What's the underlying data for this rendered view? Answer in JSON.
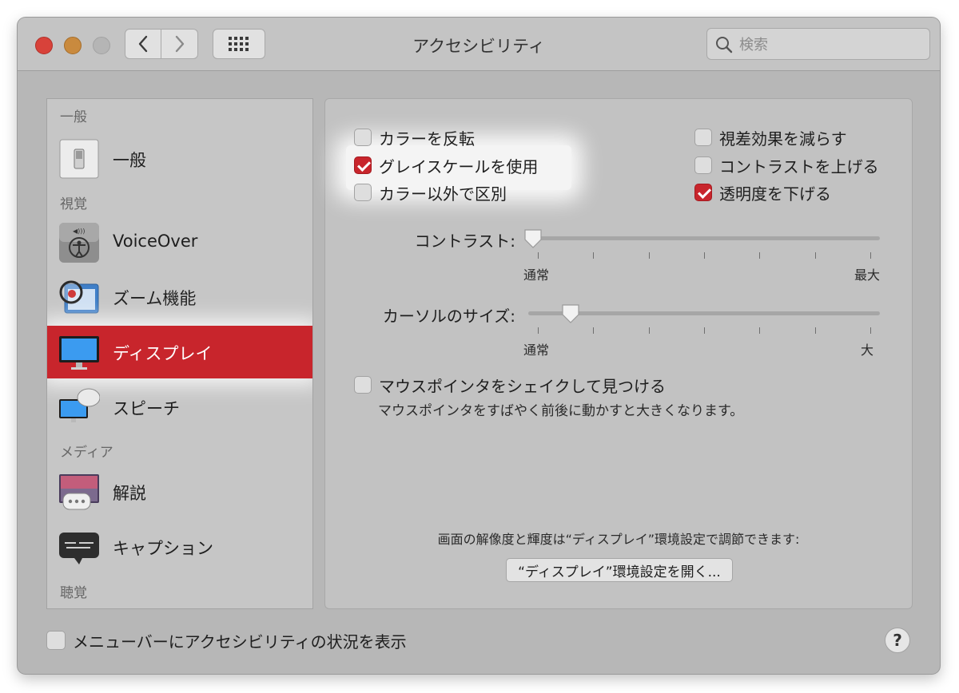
{
  "window": {
    "title": "アクセシビリティ",
    "search_placeholder": "検索"
  },
  "sidebar": {
    "sections": [
      {
        "header": "一般"
      },
      {
        "header": "視覚"
      },
      {
        "header": "メディア"
      },
      {
        "header": "聴覚"
      }
    ],
    "items": [
      {
        "label": "一般",
        "icon": "general-switch-icon"
      },
      {
        "label": "VoiceOver",
        "icon": "voiceover-icon"
      },
      {
        "label": "ズーム機能",
        "icon": "zoom-magnifier-icon"
      },
      {
        "label": "ディスプレイ",
        "icon": "display-monitor-icon",
        "selected": true
      },
      {
        "label": "スピーチ",
        "icon": "speech-icon"
      },
      {
        "label": "解説",
        "icon": "descriptions-icon"
      },
      {
        "label": "キャプション",
        "icon": "captions-icon"
      }
    ]
  },
  "display": {
    "checkboxes_left": [
      {
        "label": "カラーを反転",
        "checked": false
      },
      {
        "label": "グレイスケールを使用",
        "checked": true
      },
      {
        "label": "カラー以外で区別",
        "checked": false
      }
    ],
    "checkboxes_right": [
      {
        "label": "視差効果を減らす",
        "checked": false
      },
      {
        "label": "コントラストを上げる",
        "checked": false
      },
      {
        "label": "透明度を下げる",
        "checked": true
      }
    ],
    "contrast_slider": {
      "label": "コントラスト:",
      "min_label": "通常",
      "max_label": "最大",
      "value": 0.0,
      "ticks": 7
    },
    "cursor_slider": {
      "label": "カーソルのサイズ:",
      "min_label": "通常",
      "max_label": "大",
      "value": 0.12,
      "ticks": 7
    },
    "shake_checkbox": {
      "label": "マウスポインタをシェイクして見つける",
      "checked": false,
      "description": "マウスポインタをすばやく前後に動かすと大きくなります。"
    },
    "note": "画面の解像度と輝度は“ディスプレイ”環境設定で調節できます:",
    "open_button": "“ディスプレイ”環境設定を開く..."
  },
  "footer": {
    "menubar_checkbox": {
      "label": "メニューバーにアクセシビリティの状況を表示",
      "checked": false
    },
    "help_label": "?"
  },
  "colors": {
    "accent": "#c8252c",
    "window_bg": "#b7b7b7"
  }
}
